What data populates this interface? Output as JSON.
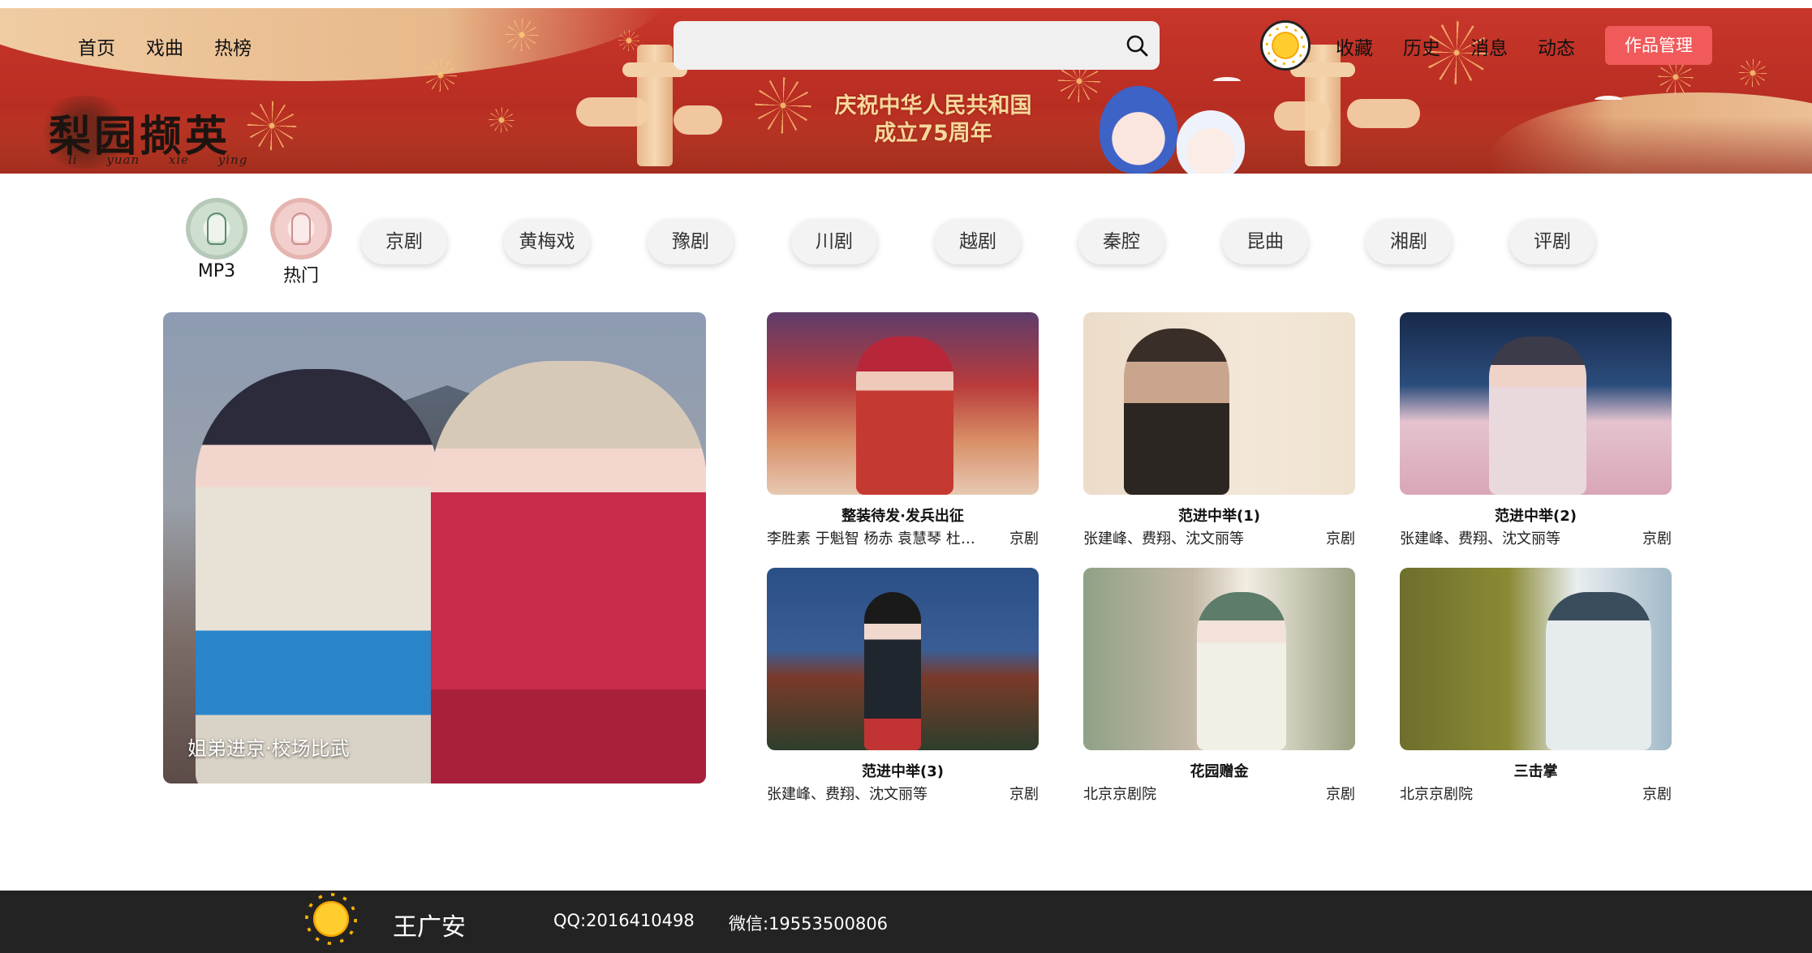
{
  "header": {
    "nav_left": [
      "首页",
      "戏曲",
      "热榜"
    ],
    "search_placeholder": "",
    "nav_right": [
      "收藏",
      "历史",
      "消息",
      "动态"
    ],
    "works_button": "作品管理",
    "logo_text": "梨园撷英",
    "logo_pinyin": "li yuan xie ying",
    "banner_title": [
      "庆祝中华人民共和国",
      "成立75周年"
    ],
    "icons": [
      "search-icon",
      "sun-avatar-icon"
    ]
  },
  "categories": {
    "icon_items": [
      "MP3",
      "热门"
    ],
    "chips": [
      "京剧",
      "黄梅戏",
      "豫剧",
      "川剧",
      "越剧",
      "秦腔",
      "昆曲",
      "湘剧",
      "评剧"
    ]
  },
  "featured": {
    "caption": "姐弟进京·校场比武"
  },
  "videos": [
    {
      "title": "整装待发·发兵出征",
      "artist": "李胜素 于魁智 杨赤 袁慧琴 杜镇杰",
      "genre": "京剧"
    },
    {
      "title": "范进中举(1)",
      "artist": "张建峰、费翔、沈文丽等",
      "genre": "京剧"
    },
    {
      "title": "范进中举(2)",
      "artist": "张建峰、费翔、沈文丽等",
      "genre": "京剧"
    },
    {
      "title": "范进中举(3)",
      "artist": "张建峰、费翔、沈文丽等",
      "genre": "京剧"
    },
    {
      "title": "花园赠金",
      "artist": "北京京剧院",
      "genre": "京剧"
    },
    {
      "title": "三击掌",
      "artist": "北京京剧院",
      "genre": "京剧"
    }
  ],
  "footer": {
    "name": "王广安",
    "qq": "QQ:2016410498",
    "wechat": "微信:19553500806"
  },
  "colors": {
    "banner_red": "#c8362a",
    "works_button": "#f05a5a",
    "footer_bg": "#232323"
  }
}
